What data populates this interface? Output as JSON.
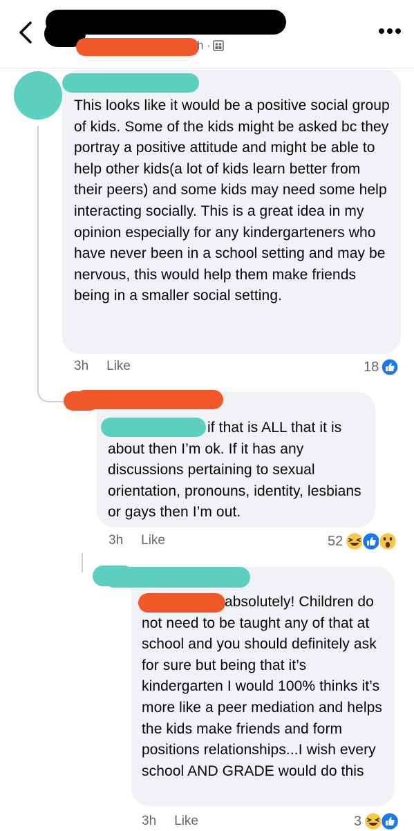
{
  "header": {
    "time_suffix": "h ·",
    "audience_icon": "friends-icon"
  },
  "comments": [
    {
      "text": "This looks like it would be a positive social group of kids. Some of the kids might be asked bc they portray a positive attitude and might be able to help other kids(a lot of kids learn better from their peers) and some kids may need some help interacting socially. This is a great idea in my opinion especially for any kindergarteners who have never been in a school setting and may be nervous, this would help them make friends being in a smaller social setting.",
      "time": "3h",
      "like_label": "Like",
      "reaction_count": "18",
      "reactions": [
        "like-icon"
      ]
    },
    {
      "text": "if that is ALL that it is about then I’m ok. If it has any discussions pertaining to sexual orientation, pronouns, identity, lesbians or gays then I’m out.",
      "time": "3h",
      "like_label": "Like",
      "reaction_count": "52",
      "reactions": [
        "haha-icon",
        "like-icon",
        "wow-icon"
      ]
    },
    {
      "text": "absolutely! Children do not need to be taught any of that at school and you should definitely ask for sure but being that it’s kindergarten I would 100% thinks it’s more like a peer mediation and helps the kids make friends and form positions relationships...I wish every school AND GRADE would do this",
      "time": "3h",
      "like_label": "Like",
      "reaction_count": "3",
      "reactions": [
        "haha-icon",
        "like-icon"
      ]
    }
  ],
  "colors": {
    "redaction_black": "#000000",
    "redaction_orange": "#f0582a",
    "redaction_teal": "#5ccfbf",
    "bubble": "#f0f2f5",
    "like_blue": "#1877f2",
    "reaction_yellow": "#f7c843"
  }
}
